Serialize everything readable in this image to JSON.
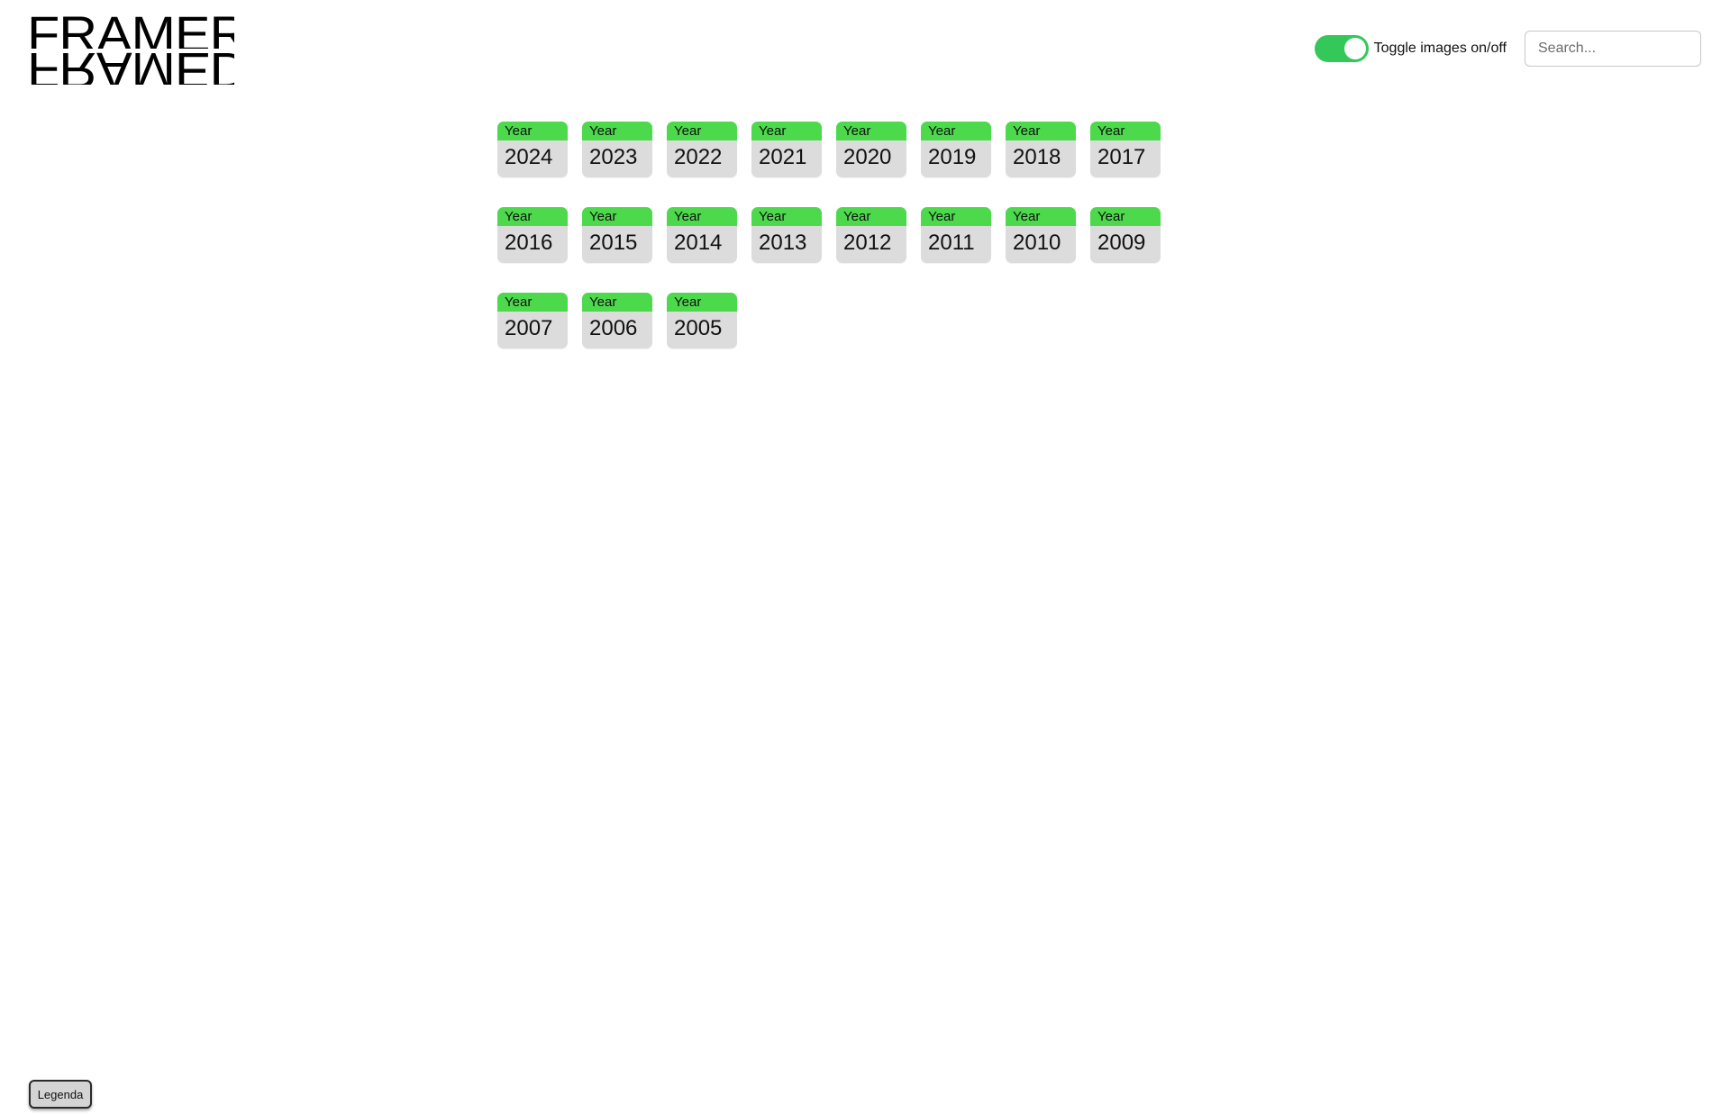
{
  "logo": {
    "top_text": "FRAMER",
    "bottom_text": "FRAMED"
  },
  "controls": {
    "toggle_label": "Toggle images on/off",
    "toggle_on": true,
    "search_placeholder": "Search..."
  },
  "colors": {
    "toggle_on": "#34c759",
    "card_header": "#4cd94c",
    "card_body": "#dcdcdc"
  },
  "years": [
    {
      "label": "Year",
      "year": "2024"
    },
    {
      "label": "Year",
      "year": "2023"
    },
    {
      "label": "Year",
      "year": "2022"
    },
    {
      "label": "Year",
      "year": "2021"
    },
    {
      "label": "Year",
      "year": "2020"
    },
    {
      "label": "Year",
      "year": "2019"
    },
    {
      "label": "Year",
      "year": "2018"
    },
    {
      "label": "Year",
      "year": "2017"
    },
    {
      "label": "Year",
      "year": "2016"
    },
    {
      "label": "Year",
      "year": "2015"
    },
    {
      "label": "Year",
      "year": "2014"
    },
    {
      "label": "Year",
      "year": "2013"
    },
    {
      "label": "Year",
      "year": "2012"
    },
    {
      "label": "Year",
      "year": "2011"
    },
    {
      "label": "Year",
      "year": "2010"
    },
    {
      "label": "Year",
      "year": "2009"
    },
    {
      "label": "Year",
      "year": "2007"
    },
    {
      "label": "Year",
      "year": "2006"
    },
    {
      "label": "Year",
      "year": "2005"
    }
  ],
  "legenda_button": "Legenda"
}
